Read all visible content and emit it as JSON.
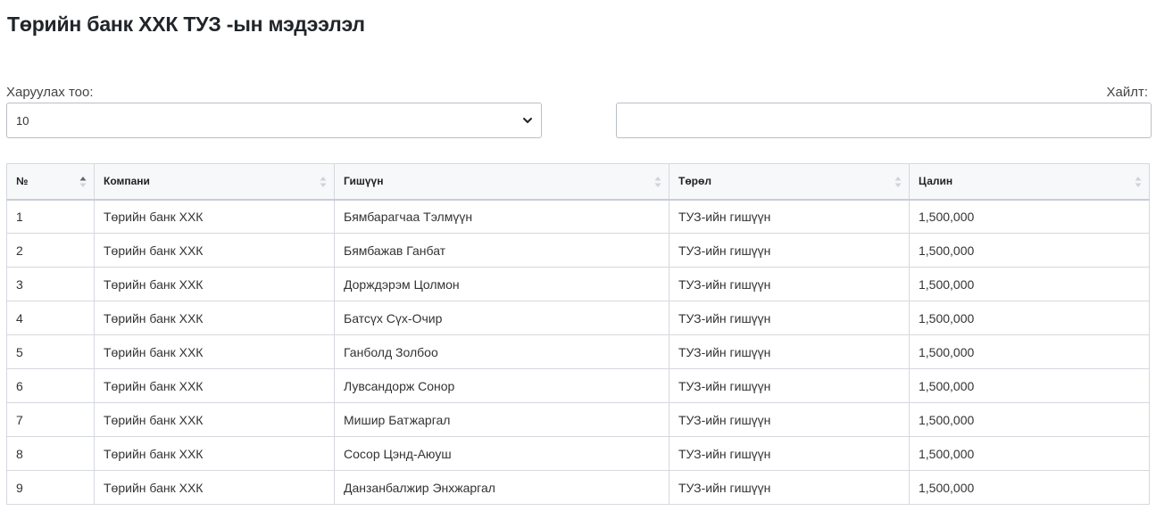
{
  "page": {
    "title": "Төрийн банк ХХК ТУЗ -ын мэдээлэл"
  },
  "controls": {
    "length_label": "Харуулах тоо:",
    "length_value": "10",
    "search_label": "Хайлт:",
    "search_value": ""
  },
  "table": {
    "columns": [
      "№",
      "Компани",
      "Гишүүн",
      "Төрөл",
      "Цалин"
    ],
    "sorted_column": 0,
    "rows": [
      [
        "1",
        "Төрийн банк ХХК",
        "Бямбарагчаа Тэлмүүн",
        "ТУЗ-ийн гишүүн",
        "1,500,000"
      ],
      [
        "2",
        "Төрийн банк ХХК",
        "Бямбажав Ганбат",
        "ТУЗ-ийн гишүүн",
        "1,500,000"
      ],
      [
        "3",
        "Төрийн банк ХХК",
        "Дорждэрэм Цолмон",
        "ТУЗ-ийн гишүүн",
        "1,500,000"
      ],
      [
        "4",
        "Төрийн банк ХХК",
        "Батсүх Сүх-Очир",
        "ТУЗ-ийн гишүүн",
        "1,500,000"
      ],
      [
        "5",
        "Төрийн банк ХХК",
        "Ганболд Золбоо",
        "ТУЗ-ийн гишүүн",
        "1,500,000"
      ],
      [
        "6",
        "Төрийн банк ХХК",
        "Лувсандорж Сонор",
        "ТУЗ-ийн гишүүн",
        "1,500,000"
      ],
      [
        "7",
        "Төрийн банк ХХК",
        "Мишир Батжаргал",
        "ТУЗ-ийн гишүүн",
        "1,500,000"
      ],
      [
        "8",
        "Төрийн банк ХХК",
        "Сосор Цэнд-Аюуш",
        "ТУЗ-ийн гишүүн",
        "1,500,000"
      ],
      [
        "9",
        "Төрийн банк ХХК",
        "Данзанбалжир Энхжаргал",
        "ТУЗ-ийн гишүүн",
        "1,500,000"
      ]
    ]
  }
}
